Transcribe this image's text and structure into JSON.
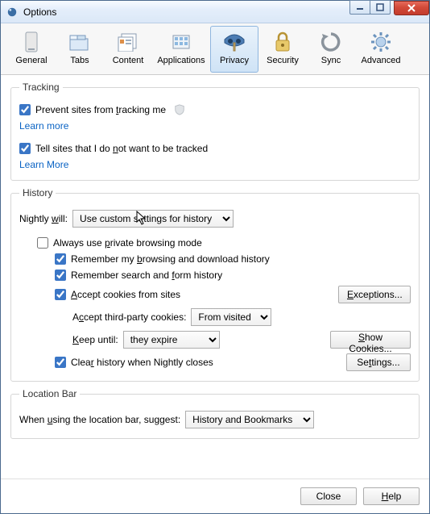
{
  "window": {
    "title": "Options"
  },
  "toolbar": {
    "general": "General",
    "tabs": "Tabs",
    "content": "Content",
    "applications": "Applications",
    "privacy": "Privacy",
    "security": "Security",
    "sync": "Sync",
    "advanced": "Advanced",
    "selected": "privacy"
  },
  "tracking": {
    "legend": "Tracking",
    "prevent": {
      "checked": true,
      "pre": "Prevent sites from ",
      "u": "t",
      "post": "racking me"
    },
    "learn_more_1": "Learn more",
    "dnt": {
      "checked": true,
      "pre": "Tell sites that I do ",
      "u": "n",
      "post": "ot want to be tracked"
    },
    "learn_more_2": "Learn More"
  },
  "history": {
    "legend": "History",
    "nightly_pre": "Nightly ",
    "nightly_u": "w",
    "nightly_post": "ill:",
    "mode_value": "Use custom settings for history",
    "always_private": {
      "checked": false,
      "pre": "Always use ",
      "u": "p",
      "post": "rivate browsing mode"
    },
    "remember_browsing": {
      "checked": true,
      "pre": "Remember my ",
      "u": "b",
      "post": "rowsing and download history"
    },
    "remember_search": {
      "checked": true,
      "pre": "Remember search and ",
      "u": "f",
      "post": "orm history"
    },
    "accept_cookies": {
      "checked": true,
      "pre": "",
      "u": "A",
      "post": "ccept cookies from sites"
    },
    "exceptions_btn": "Exceptions...",
    "third_party_label": {
      "pre": "A",
      "u": "c",
      "post": "cept third-party cookies:"
    },
    "third_party_value": "From visited",
    "keep_label": {
      "pre": "",
      "u": "K",
      "post": "eep until:"
    },
    "keep_value": "they expire",
    "show_cookies_btn": "Show Cookies...",
    "clear_on_close": {
      "checked": true,
      "pre": "Clea",
      "u": "r",
      "post": " history when Nightly closes"
    },
    "settings_btn": "Settings..."
  },
  "locationbar": {
    "legend": "Location Bar",
    "label": {
      "pre": "When ",
      "u": "u",
      "post": "sing the location bar, suggest:"
    },
    "value": "History and Bookmarks"
  },
  "footer": {
    "close": "Close",
    "help_u": "H",
    "help_post": "elp"
  }
}
